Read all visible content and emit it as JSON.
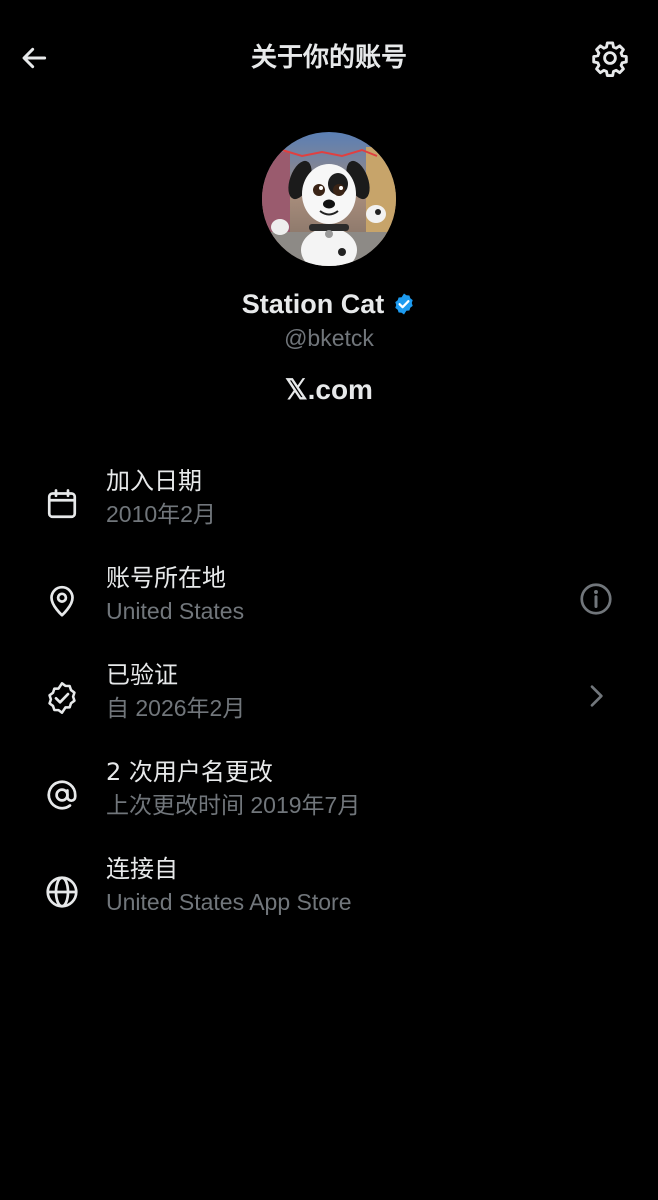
{
  "header": {
    "title": "关于你的账号",
    "back_icon": "arrow-left-icon",
    "settings_icon": "gear-icon"
  },
  "profile": {
    "display_name": "Station Cat",
    "handle": "@bketck",
    "site": "𝕏.com",
    "verified": true,
    "avatar": "dalmatian-puppy-avatar"
  },
  "info": [
    {
      "icon": "calendar-icon",
      "title": "加入日期",
      "subtitle": "2010年2月"
    },
    {
      "icon": "location-pin-icon",
      "title": "账号所在地",
      "subtitle": "United States",
      "action_icon": "info-icon"
    },
    {
      "icon": "verified-check-icon",
      "title": "已验证",
      "subtitle": "自 2026年2月",
      "action_icon": "chevron-right-icon"
    },
    {
      "icon": "at-sign-icon",
      "title": "2 次用户名更改",
      "subtitle": "上次更改时间 2019年7月"
    },
    {
      "icon": "globe-icon",
      "title": "连接自",
      "subtitle": "United States App Store"
    }
  ],
  "colors": {
    "background": "#000000",
    "primary_text": "#e7e9ea",
    "secondary_text": "#71767b",
    "verified_blue": "#1d9bf0"
  }
}
